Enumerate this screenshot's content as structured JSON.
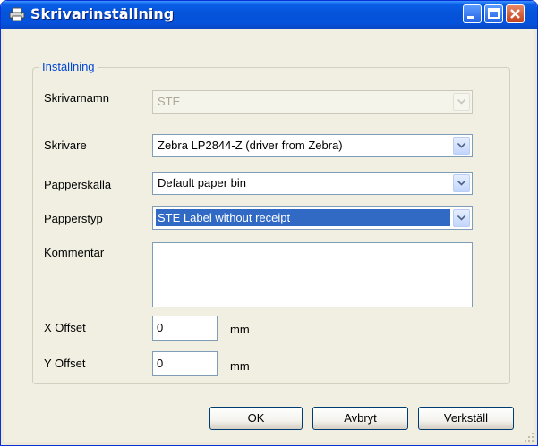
{
  "window": {
    "title": "Skrivarinställning"
  },
  "group": {
    "legend": "Inställning"
  },
  "fields": {
    "printer_name": {
      "label": "Skrivarnamn",
      "value": "STE"
    },
    "printer": {
      "label": "Skrivare",
      "value": "Zebra LP2844-Z (driver from Zebra)"
    },
    "paper_source": {
      "label": "Papperskälla",
      "value": "Default paper bin"
    },
    "paper_type": {
      "label": "Papperstyp",
      "value": "STE Label without receipt"
    },
    "comment": {
      "label": "Kommentar",
      "value": ""
    },
    "x_offset": {
      "label": "X Offset",
      "value": "0",
      "unit": "mm"
    },
    "y_offset": {
      "label": "Y Offset",
      "value": "0",
      "unit": "mm"
    }
  },
  "buttons": {
    "ok": "OK",
    "cancel": "Avbryt",
    "apply": "Verkställ"
  },
  "colors": {
    "titlebar": "#0453d8",
    "selection": "#316ac5",
    "legend": "#0046d5",
    "background": "#f1efe2"
  }
}
